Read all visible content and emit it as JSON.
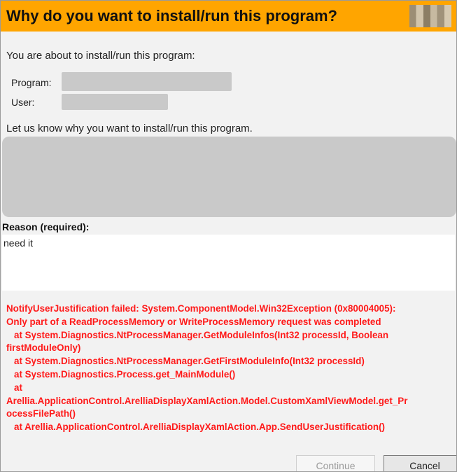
{
  "dialog": {
    "title": "Why do you want to install/run this program?",
    "intro": "You are about to install/run this program:",
    "program_label": "Program:",
    "user_label": "User:",
    "ask": "Let us know why you want to install/run this program.",
    "reason_label": "Reason (required):",
    "reason_value": "need it"
  },
  "error": {
    "lines": [
      "NotifyUserJustification failed: System.ComponentModel.Win32Exception (0x80004005):",
      "Only part of a ReadProcessMemory or WriteProcessMemory request was completed",
      "at System.Diagnostics.NtProcessManager.GetModuleInfos(Int32 processId, Boolean",
      "firstModuleOnly)",
      "at System.Diagnostics.NtProcessManager.GetFirstModuleInfo(Int32 processId)",
      "at System.Diagnostics.Process.get_MainModule()",
      "at",
      "Arellia.ApplicationControl.ArelliaDisplayXamlAction.Model.CustomXamlViewModel.get_Pr",
      "ocessFilePath()",
      "at Arellia.ApplicationControl.ArelliaDisplayXamlAction.App.SendUserJustification()"
    ],
    "color": "#ff1a1a"
  },
  "buttons": {
    "continue": "Continue",
    "cancel": "Cancel"
  },
  "colors": {
    "titlebar": "#ffa500",
    "redaction": "#c9c9c9"
  }
}
